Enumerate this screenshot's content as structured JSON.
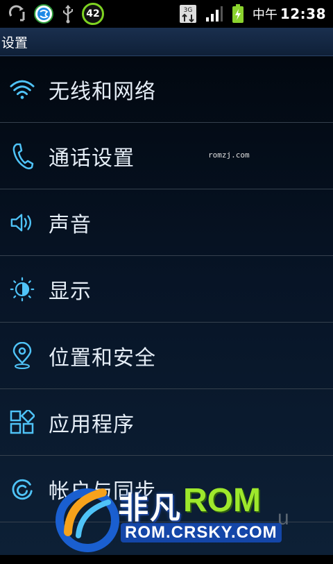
{
  "status_bar": {
    "ampm": "中午",
    "time": "12:38",
    "battery_level_badge": "42",
    "icons": [
      "sync-icon",
      "shield-app-icon",
      "usb-icon",
      "battery-level-badge",
      "3g-data-icon",
      "signal-icon",
      "battery-icon"
    ]
  },
  "title": "设置",
  "items": [
    {
      "label": "无线和网络",
      "icon": "wifi-icon"
    },
    {
      "label": "通话设置",
      "icon": "phone-icon"
    },
    {
      "label": "声音",
      "icon": "speaker-icon"
    },
    {
      "label": "显示",
      "icon": "brightness-icon"
    },
    {
      "label": "位置和安全",
      "icon": "location-icon"
    },
    {
      "label": "应用程序",
      "icon": "apps-icon"
    },
    {
      "label": "帐户与同步",
      "icon": "sync-account-icon"
    }
  ],
  "watermark_small": "romzj.com",
  "logo": {
    "cn": "非凡",
    "rom": "ROM",
    "url": "ROM.CRSKY.COM",
    "ghost": "u"
  },
  "colors": {
    "accent": "#4fc3f7",
    "title_bar": "#1a2f4e",
    "divider": "#36414e",
    "logo_green": "#9ee82c"
  }
}
